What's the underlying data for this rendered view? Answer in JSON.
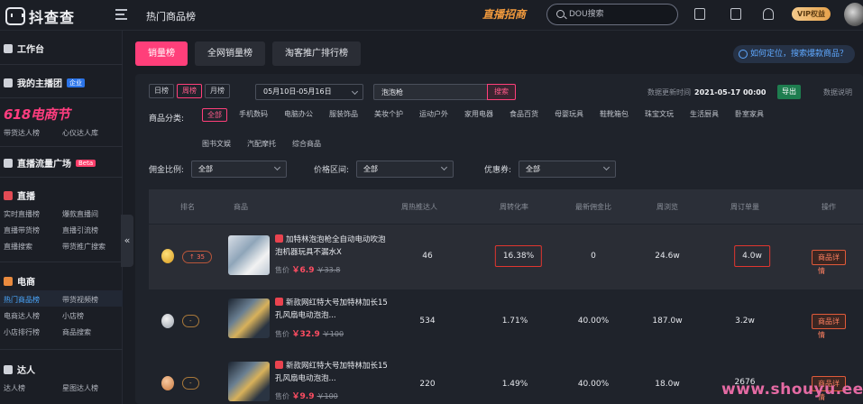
{
  "topbar": {
    "logo_text": "抖查查",
    "page_title": "热门商品榜",
    "live_badge": "直播招商",
    "search_placeholder": "DOU搜索",
    "vip_label": "VIP权益"
  },
  "sidebar": {
    "workbench": "工作台",
    "my_team": "我的主播团",
    "my_team_tag": "企业",
    "promo_title": "618电商节",
    "promo_items": [
      "带货达人榜",
      "心仪达人库"
    ],
    "live_traffic": "直播流量广场",
    "live_traffic_tag": "Beta",
    "live_section": "直播",
    "live_items": [
      "实时直播榜",
      "爆款直播间",
      "直播带货榜",
      "直播引流榜",
      "直播搜索",
      "带货推广搜索"
    ],
    "ecom_section": "电商",
    "ecom_items": [
      "热门商品榜",
      "带货视频榜",
      "电商达人榜",
      "小店榜",
      "小店排行榜",
      "商品搜索"
    ],
    "talent_section": "达人",
    "talent_items": [
      "达人榜",
      "星图达人榜"
    ],
    "collapse_glyph": "«"
  },
  "tabs": [
    "销量榜",
    "全网销量榜",
    "淘客推广排行榜"
  ],
  "help_link": "如何定位，搜索爆款商品？",
  "period_options": [
    "日榜",
    "周榜",
    "月榜"
  ],
  "date_range": "05月10日-05月16日",
  "keyword": "泡泡枪",
  "search_button": "搜索",
  "update_label": "数据更新时间",
  "update_time": "2021-05-17 00:00",
  "export_button": "导出",
  "data_note": "数据说明",
  "category_label": "商品分类:",
  "categories": [
    "全部",
    "手机数码",
    "电脑办公",
    "服装饰品",
    "美妆个护",
    "运动户外",
    "家用电器",
    "食品百货",
    "母婴玩具",
    "鞋靴箱包",
    "珠宝文玩",
    "生活厨具",
    "卧室家具",
    "图书文娱",
    "汽配摩托",
    "综合商品"
  ],
  "filters": [
    {
      "label": "佣金比例:",
      "value": "全部"
    },
    {
      "label": "价格区间:",
      "value": "全部"
    },
    {
      "label": "优惠券:",
      "value": "全部"
    }
  ],
  "table": {
    "headers": [
      "排名",
      "商品",
      "周热推达人",
      "周转化率",
      "最新佣金比",
      "周浏览",
      "周订单量",
      "操作"
    ],
    "rows": [
      {
        "rank_badge": "↑ 35",
        "name": "加特林泡泡枪全自动电动吹泡泡机器玩具不漏水X",
        "price_label": "售价",
        "price": "￥6.9",
        "orig_price": "￥33.8",
        "talents": "46",
        "conversion": "16.38%",
        "commission": "0",
        "views": "24.6w",
        "orders": "4.0w",
        "action": "商品详情"
      },
      {
        "rank_badge": "-",
        "name": "新款网红特大号加特林加长15孔风扇电动泡泡...",
        "price_label": "售价",
        "price": "￥32.9",
        "orig_price": "￥100",
        "talents": "534",
        "conversion": "1.71%",
        "commission": "40.00%",
        "views": "187.0w",
        "orders": "3.2w",
        "action": "商品详情"
      },
      {
        "rank_badge": "-",
        "name": "新款网红特大号加特林加长15孔风扇电动泡泡...",
        "price_label": "售价",
        "price": "￥9.9",
        "orig_price": "￥100",
        "talents": "220",
        "conversion": "1.49%",
        "commission": "40.00%",
        "views": "18.0w",
        "orders": "2676",
        "action": "商品详情"
      }
    ]
  },
  "watermark": "www.shouyu.ee",
  "colors": {
    "accent": "#ff3f7a",
    "highlight_box": "#e0362f",
    "link": "#4aa8ff"
  }
}
